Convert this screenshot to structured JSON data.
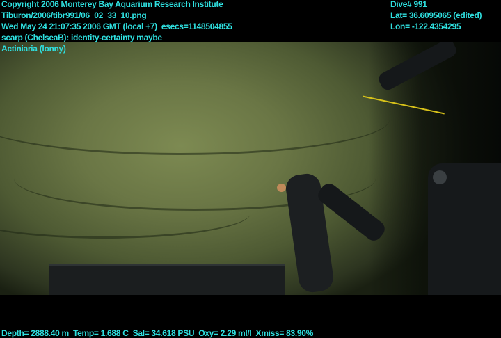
{
  "overlay_top_left": {
    "copyright": "Copyright 2006 Monterey Bay Aquarium Research Institute",
    "file": "Tiburon/2006/tibr991/06_02_33_10.png",
    "datetime": "Wed May 24 21:07:35 2006 GMT (local +7)  esecs=1148504855",
    "annotation": "scarp (ChelseaB): identity-certainty maybe",
    "taxon": "Actiniaria (lonny)"
  },
  "overlay_top_right": {
    "dive": "Dive# 991",
    "lat": "Lat= 36.6095065 (edited)",
    "lon": "Lon= -122.4354295"
  },
  "overlay_bottom": {
    "sensors": "Depth= 2888.40 m  Temp= 1.688 C  Sal= 34.618 PSU  Oxy= 2.29 ml/l  Xmiss= 83.90%"
  },
  "colors": {
    "overlay_text": "#2fe0e0",
    "seafloor": "#6a7645"
  }
}
